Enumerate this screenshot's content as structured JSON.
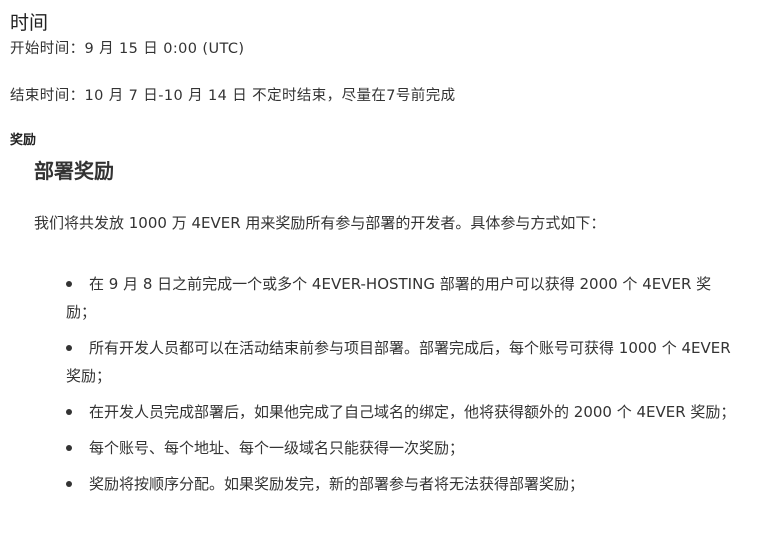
{
  "time_section": {
    "title": "时间",
    "start": "开始时间：9 月 15 日 0:00 (UTC)",
    "end": "结束时间：10 月 7 日-10 月 14 日 不定时结束，尽量在7号前完成"
  },
  "reward_section": {
    "label": "奖励",
    "heading": "部署奖励",
    "intro": "我们将共发放 1000 万 4EVER 用来奖励所有参与部署的开发者。具体参与方式如下：",
    "items": [
      {
        "text": "在 9 月 8 日之前完成一个或多个 4EVER-HOSTING 部署的用户可以获得 2000 个 4EVER 奖励；"
      },
      {
        "text": "所有开发人员都可以在活动结束前参与项目部署。部署完成后，每个账号可获得 1000 个 4EVER 奖励；"
      },
      {
        "text": "在开发人员完成部署后，如果他完成了自己域名的绑定，他将获得额外的 2000 个 4EVER 奖励；"
      },
      {
        "text": "每个账号、每个地址、每个一级域名只能获得一次奖励；"
      },
      {
        "text": "奖励将按顺序分配。如果奖励发完，新的部署参与者将无法获得部署奖励；"
      }
    ]
  }
}
